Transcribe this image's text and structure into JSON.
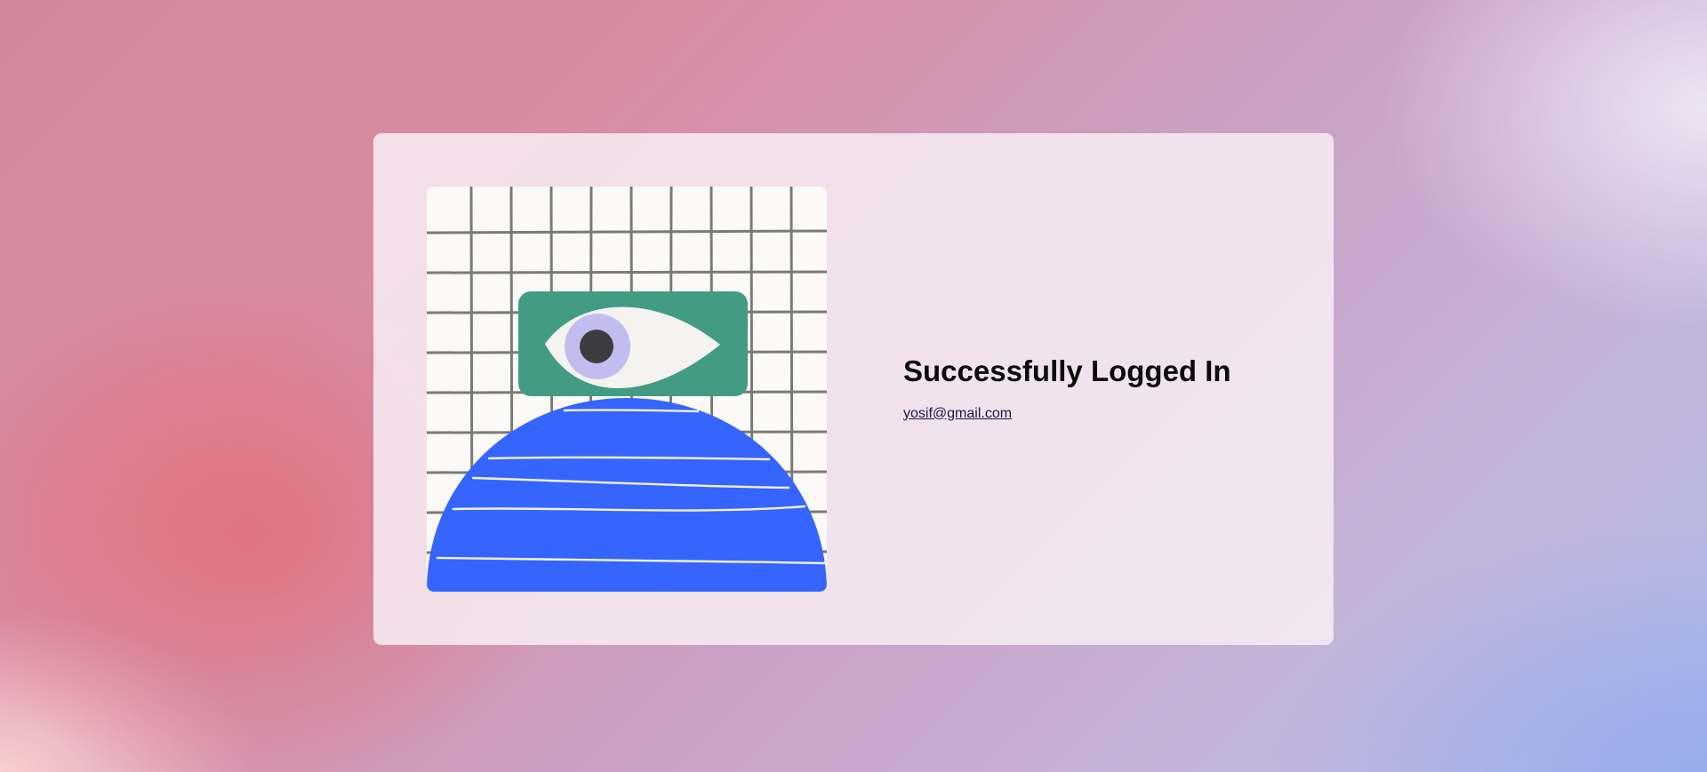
{
  "card": {
    "title": "Successfully Logged In",
    "email": "yosif@gmail.com"
  },
  "illustration": {
    "icon": "eye-illustration",
    "colors": {
      "grid_background": "#fbfaf7",
      "grid_lines": "#7a7a78",
      "eye_panel": "#429c83",
      "iris": "#c3bcef",
      "pupil": "#3d3d3f",
      "dome": "#3565fd"
    }
  }
}
